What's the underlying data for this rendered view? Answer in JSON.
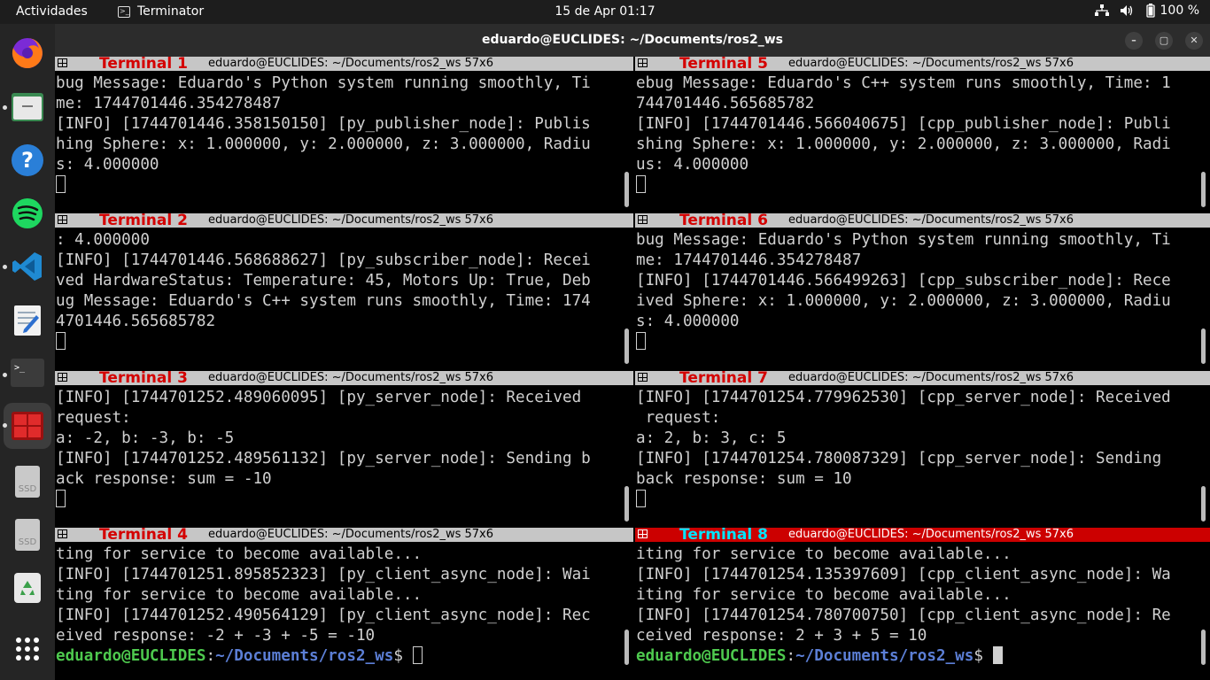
{
  "topbar": {
    "activities": "Actividades",
    "app_name": "Terminator",
    "clock": "15 de Apr  01:17",
    "battery": "100 %"
  },
  "dock": {
    "items": [
      "firefox-icon",
      "files-icon",
      "help-icon",
      "spotify-icon",
      "vscode-icon",
      "text-editor-icon",
      "terminal-icon",
      "terminator-icon",
      "ssd-drive-icon",
      "ssd-drive-icon",
      "trash-icon",
      "app-grid-icon"
    ],
    "ssd_label": "SSD"
  },
  "window": {
    "title": "eduardo@EUCLIDES: ~/Documents/ros2_ws",
    "minimize": "–",
    "maximize": "▢",
    "close": "✕"
  },
  "panes": [
    {
      "label": "Terminal 1",
      "title": "eduardo@EUCLIDES: ~/Documents/ros2_ws 57x6",
      "lines": [
        "bug Message: Eduardo's Python system running smoothly, Ti",
        "me: 1744701446.354278487",
        "[INFO] [1744701446.358150150] [py_publisher_node]: Publis",
        "hing Sphere: x: 1.000000, y: 2.000000, z: 3.000000, Radiu",
        "s: 4.000000"
      ]
    },
    {
      "label": "Terminal 5",
      "title": "eduardo@EUCLIDES: ~/Documents/ros2_ws 57x6",
      "lines": [
        "ebug Message: Eduardo's C++ system runs smoothly, Time: 1",
        "744701446.565685782",
        "[INFO] [1744701446.566040675] [cpp_publisher_node]: Publi",
        "shing Sphere: x: 1.000000, y: 2.000000, z: 3.000000, Radi",
        "us: 4.000000"
      ]
    },
    {
      "label": "Terminal 2",
      "title": "eduardo@EUCLIDES: ~/Documents/ros2_ws 57x6",
      "lines": [
        ": 4.000000",
        "[INFO] [1744701446.568688627] [py_subscriber_node]: Recei",
        "ved HardwareStatus: Temperature: 45, Motors Up: True, Deb",
        "ug Message: Eduardo's C++ system runs smoothly, Time: 174",
        "4701446.565685782"
      ]
    },
    {
      "label": "Terminal 6",
      "title": "eduardo@EUCLIDES: ~/Documents/ros2_ws 57x6",
      "lines": [
        "bug Message: Eduardo's Python system running smoothly, Ti",
        "me: 1744701446.354278487",
        "[INFO] [1744701446.566499263] [cpp_subscriber_node]: Rece",
        "ived Sphere: x: 1.000000, y: 2.000000, z: 3.000000, Radiu",
        "s: 4.000000"
      ]
    },
    {
      "label": "Terminal 3",
      "title": "eduardo@EUCLIDES: ~/Documents/ros2_ws 57x6",
      "lines": [
        "[INFO] [1744701252.489060095] [py_server_node]: Received",
        "request:",
        "a: -2, b: -3, b: -5",
        "[INFO] [1744701252.489561132] [py_server_node]: Sending b",
        "ack response: sum = -10"
      ]
    },
    {
      "label": "Terminal 7",
      "title": "eduardo@EUCLIDES: ~/Documents/ros2_ws 57x6",
      "lines": [
        "[INFO] [1744701254.779962530] [cpp_server_node]: Received",
        " request:",
        "a: 2, b: 3, c: 5",
        "[INFO] [1744701254.780087329] [cpp_server_node]: Sending",
        "back response: sum = 10"
      ]
    },
    {
      "label": "Terminal 4",
      "title": "eduardo@EUCLIDES: ~/Documents/ros2_ws 57x6",
      "lines": [
        "ting for service to become available...",
        "[INFO] [1744701251.895852323] [py_client_async_node]: Wai",
        "ting for service to become available...",
        "[INFO] [1744701252.490564129] [py_client_async_node]: Rec",
        "eived response: -2 + -3 + -5 = -10"
      ]
    },
    {
      "label": "Terminal 8",
      "title": "eduardo@EUCLIDES: ~/Documents/ros2_ws 57x6",
      "lines": [
        "iting for service to become available...",
        "[INFO] [1744701254.135397609] [cpp_client_async_node]: Wa",
        "iting for service to become available...",
        "[INFO] [1744701254.780700750] [cpp_client_async_node]: Re",
        "ceived response: 2 + 3 + 5 = 10"
      ]
    }
  ],
  "prompt": {
    "user": "eduardo@EUCLIDES",
    "sep": ":",
    "path": "~/Documents/ros2_ws",
    "sign": "$ "
  },
  "colors": {
    "active_header": "#cc0000",
    "inactive_header": "#c6c6c6",
    "label_red": "#d40000",
    "label_active": "#00e5ff",
    "prompt_user": "#4ec94e",
    "prompt_path": "#5c7fd6"
  }
}
